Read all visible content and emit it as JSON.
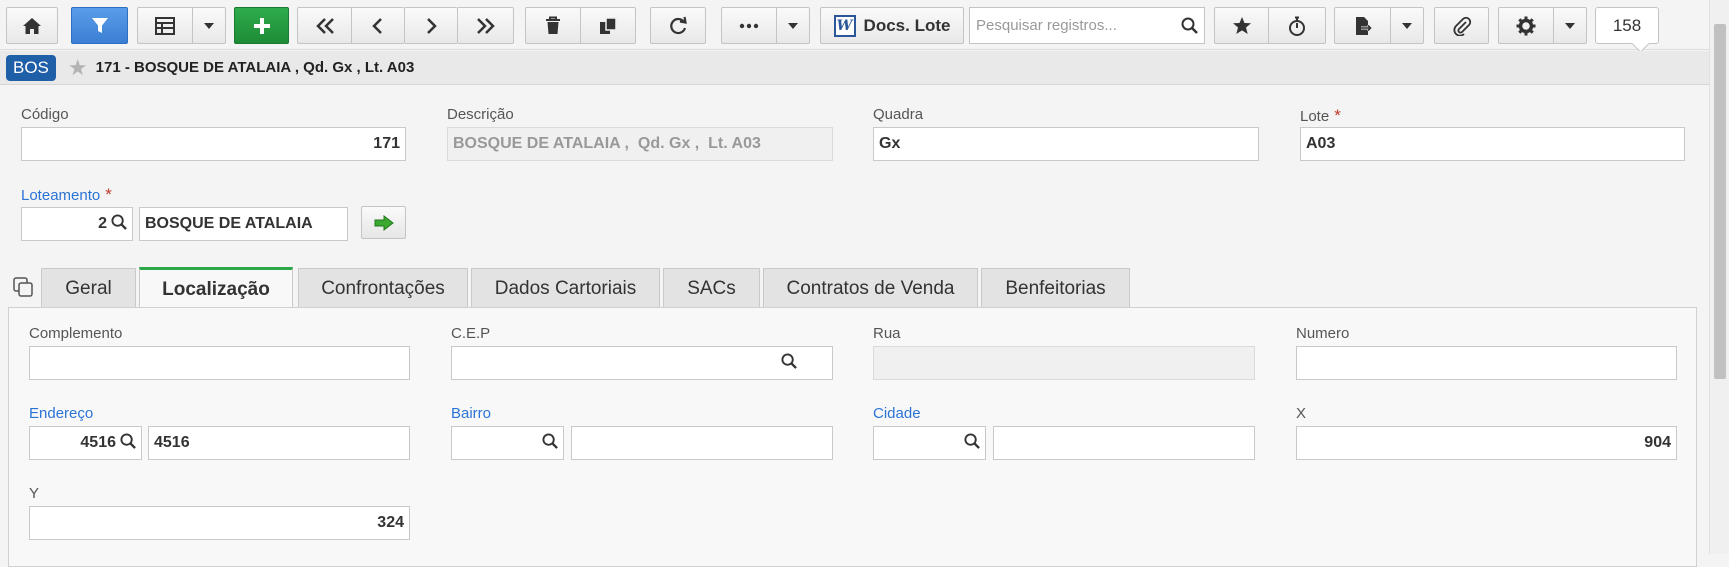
{
  "toolbar": {
    "search_placeholder": "Pesquisar registros...",
    "docs_label": "Docs. Lote",
    "record_count": "158"
  },
  "header": {
    "badge": "BOS",
    "title": "171 - BOSQUE DE ATALAIA , Qd. Gx , Lt. A03"
  },
  "form": {
    "codigo": {
      "label": "Código",
      "value": "171"
    },
    "descricao": {
      "label": "Descrição",
      "value": "BOSQUE DE ATALAIA ,  Qd. Gx ,  Lt. A03"
    },
    "quadra": {
      "label": "Quadra",
      "value": "Gx"
    },
    "lote": {
      "label": "Lote",
      "value": "A03",
      "required": "*"
    },
    "loteamento": {
      "label": "Loteamento",
      "required": "*",
      "code": "2",
      "name": "BOSQUE DE ATALAIA"
    }
  },
  "tabs": [
    {
      "label": "Geral"
    },
    {
      "label": "Localização"
    },
    {
      "label": "Confrontações"
    },
    {
      "label": "Dados Cartoriais"
    },
    {
      "label": "SACs"
    },
    {
      "label": "Contratos de Venda"
    },
    {
      "label": "Benfeitorias"
    }
  ],
  "localizacao": {
    "complemento": {
      "label": "Complemento",
      "value": ""
    },
    "cep": {
      "label": "C.E.P",
      "value": ""
    },
    "rua": {
      "label": "Rua",
      "value": ""
    },
    "numero": {
      "label": "Numero",
      "value": ""
    },
    "endereco": {
      "label": "Endereço",
      "code": "4516",
      "name": "4516"
    },
    "bairro": {
      "label": "Bairro",
      "code": "",
      "name": ""
    },
    "cidade": {
      "label": "Cidade",
      "code": "",
      "name": ""
    },
    "x": {
      "label": "X",
      "value": "904"
    },
    "y": {
      "label": "Y",
      "value": "324"
    }
  },
  "colors": {
    "primary": "#3a7fd4",
    "add": "#1e8c36",
    "active_tab": "#2aa84a",
    "link": "#2a74d6",
    "badge": "#1f5fa8"
  }
}
